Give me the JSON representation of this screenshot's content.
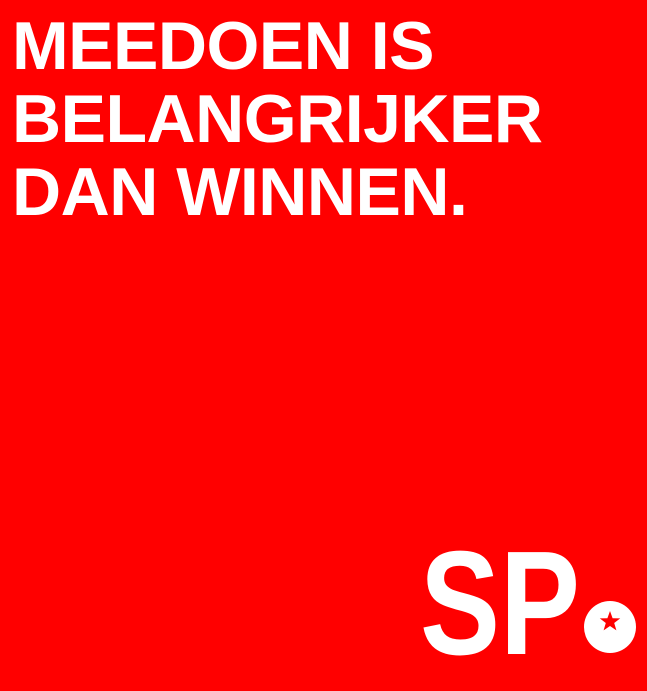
{
  "headline": {
    "lines": [
      "MEEDOEN IS",
      "BELANGRIJKER",
      "DAN WINNEN."
    ]
  },
  "logo": {
    "text": "SP",
    "icon": "tomato-star-icon"
  },
  "colors": {
    "background": "#ff0000",
    "foreground": "#ffffff"
  }
}
